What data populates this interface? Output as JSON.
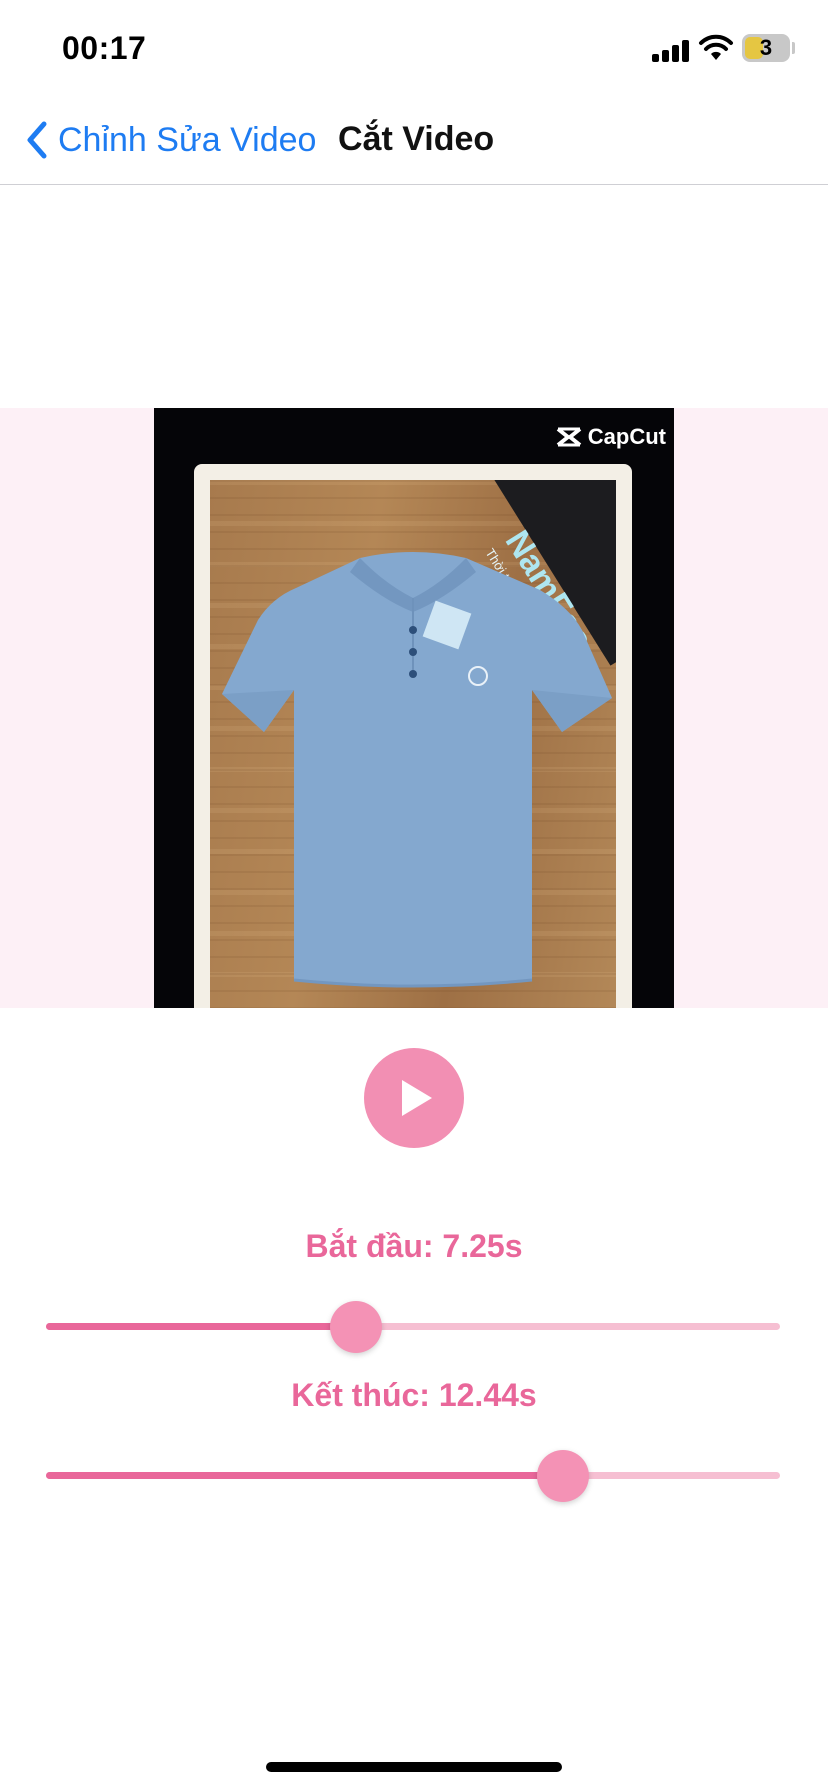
{
  "status_bar": {
    "time": "00:17",
    "battery_level": "3",
    "icons": [
      "cellular-signal-icon",
      "wifi-icon",
      "battery-icon"
    ]
  },
  "nav": {
    "back_label": "Chỉnh Sửa Video",
    "back_icon": "chevron-left-icon",
    "title": "Cắt Video"
  },
  "video": {
    "watermark": "CapCut",
    "brand_card_title": "NamFas",
    "brand_card_tagline": "Thời trang nam cao cấp xu",
    "play_icon": "play-icon"
  },
  "trim": {
    "start_label": "Bắt đầu: 7.25s",
    "end_label": "Kết thúc: 12.44s",
    "start_fraction": 0.423,
    "end_fraction": 0.704
  },
  "colors": {
    "accent": "#e9679a",
    "thumb": "#f492b5",
    "link": "#1e7cf2",
    "video_band": "#fdf0f6"
  }
}
